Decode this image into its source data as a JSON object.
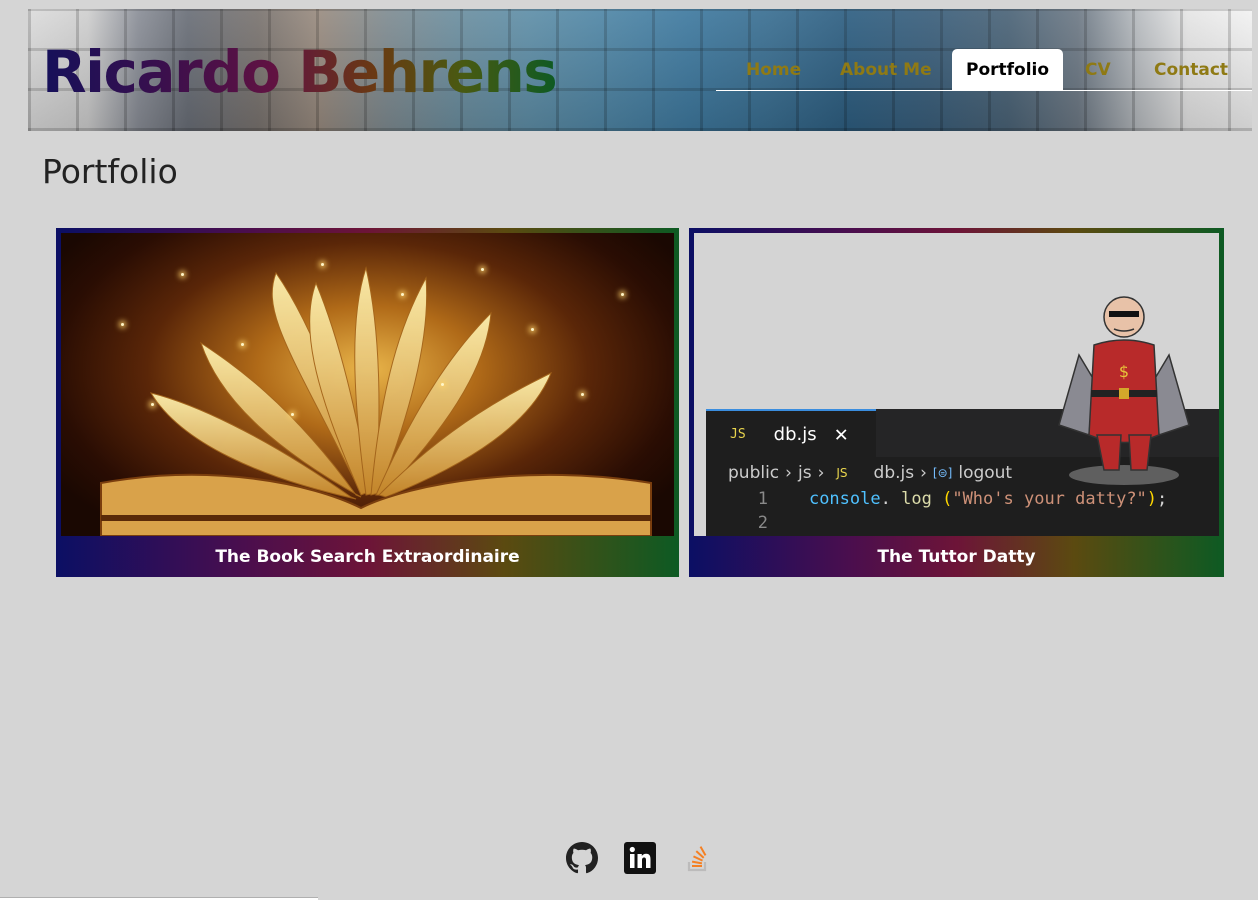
{
  "header": {
    "site_title": "Ricardo Behrens",
    "nav": [
      "Home",
      "About Me",
      "Portfolio",
      "CV",
      "Contact"
    ],
    "active_nav": "Portfolio"
  },
  "main": {
    "page_title": "Portfolio",
    "projects": [
      {
        "title": "The Book Search Extraordinaire",
        "image": "open-book-sparkles-image"
      },
      {
        "title": "The Tuttor Datty",
        "image": "code-editor-tutor-image",
        "editor": {
          "tab_icon": "JS",
          "tab_name": "db.js",
          "breadcrumb": [
            "public",
            "js",
            "JS",
            "db.js",
            "logout"
          ],
          "lines": [
            {
              "number": "1",
              "obj": "console",
              "dot": ".",
              "fn": "log",
              "open": "(",
              "str": "\"Who's your datty?\"",
              "close": ")",
              "end": ";"
            },
            {
              "number": "2"
            }
          ]
        }
      }
    ]
  },
  "footer": {
    "icons": [
      "github-icon",
      "linkedin-icon",
      "stack-overflow-icon"
    ]
  },
  "colors": {
    "background": "#d5d5d5",
    "nav_text": "#8f7a14",
    "card_gradient": [
      "#0b0f64",
      "#6d1438",
      "#0d5a23"
    ]
  }
}
